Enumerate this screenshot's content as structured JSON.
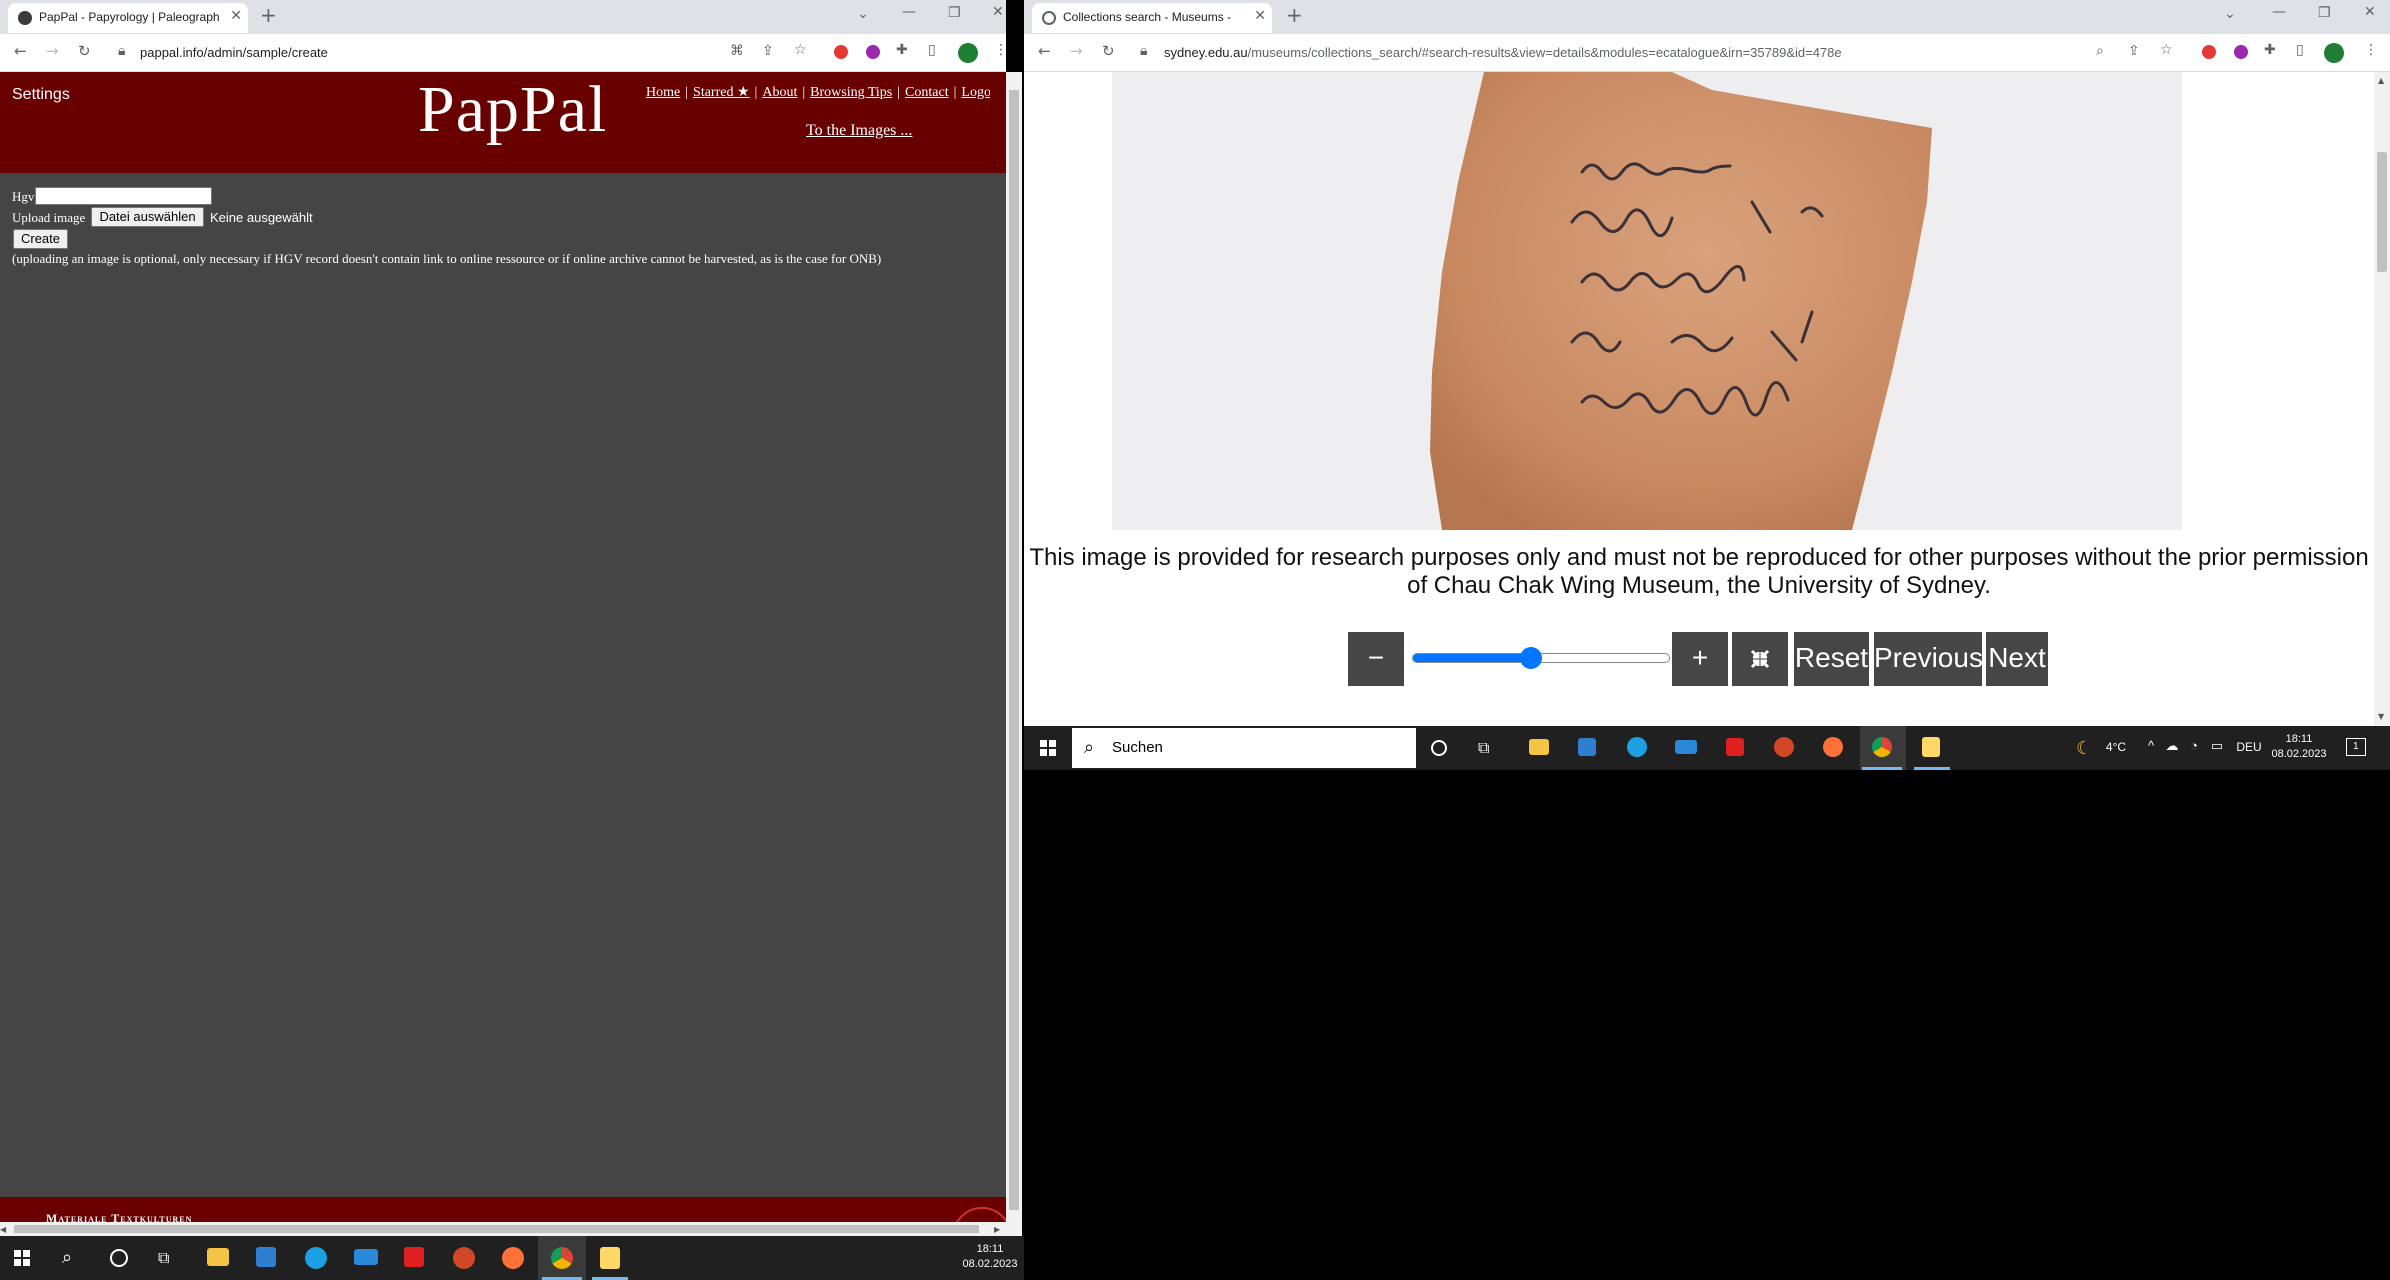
{
  "left_browser": {
    "tab_title": "PapPal - Papyrology | Paleograph",
    "url": "pappal.info/admin/sample/create"
  },
  "right_browser": {
    "tab_title": "Collections search - Museums -",
    "url_host": "sydney.edu.au",
    "url_path": "/museums/collections_search/#search-results&view=details&modules=ecatalogue&irn=35789&id=478e"
  },
  "pappal": {
    "settings_label": "Settings",
    "logo": "PapPal",
    "nav": [
      "Home",
      "Starred ★",
      "About",
      "Browsing Tips",
      "Contact",
      "Logout"
    ],
    "images_link": "To the Images ...",
    "form": {
      "hgv_label": "Hgv",
      "hgv_value": "",
      "upload_label": "Upload image",
      "file_button": "Datei auswählen",
      "file_status": "Keine ausgewählt",
      "create_button": "Create",
      "note": "(uploading an image is optional, only necessary if HGV record doesn't contain link to online ressource or if online archive cannot be harvested, as is the case for ONB)"
    },
    "footer_text": "Materiale Textkulturen"
  },
  "sydney": {
    "caption": "This image is provided for research purposes only and must not be reproduced for other purposes without the prior permission of Chau Chak Wing Museum, the University of Sydney.",
    "zoom_out_label": "−",
    "zoom_in_label": "+",
    "reset_label": "Reset",
    "previous_label": "Previous",
    "next_label": "Next",
    "zoom_level_fraction": 0.46
  },
  "taskbar_right": {
    "search_placeholder": "Suchen",
    "temperature": "4°C",
    "language": "DEU",
    "time": "18:11",
    "date": "08.02.2023",
    "notification_count": "1"
  },
  "taskbar_left": {
    "time": "18:11",
    "date": "08.02.2023"
  },
  "colors": {
    "pappal_red": "#680000",
    "pappal_body": "#454545",
    "slider_blue": "#0075ff",
    "button_dark": "#464646",
    "taskbar": "#202020"
  }
}
